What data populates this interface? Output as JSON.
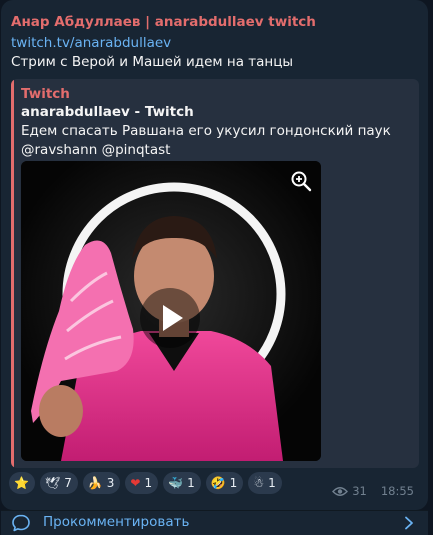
{
  "post": {
    "channel_name": "Анар Абдуллаев | anarabdullaev twitch",
    "link": "twitch.tv/anarabdullaev",
    "text": "Стрим с Верой и Машей идем на танцы"
  },
  "preview": {
    "site": "Twitch",
    "title": "anarabdullaev - Twitch",
    "description": "Едем спасать Равшана его укусил гондонский паук @ravshann @pinqtast"
  },
  "reactions": [
    {
      "emoji": "⭐",
      "icon": "star-icon",
      "count": ""
    },
    {
      "emoji": "🕊",
      "icon": "dove-icon",
      "count": "7"
    },
    {
      "emoji": "🍌",
      "icon": "banana-icon",
      "count": "3"
    },
    {
      "emoji": "❤",
      "icon": "heart-icon",
      "count": "1"
    },
    {
      "emoji": "🐳",
      "icon": "whale-icon",
      "count": "1"
    },
    {
      "emoji": "🤣",
      "icon": "rofl-icon",
      "count": "1"
    },
    {
      "emoji": "☃",
      "icon": "snowman-icon",
      "count": "1"
    }
  ],
  "meta": {
    "views": "31",
    "time": "18:55"
  },
  "comments": {
    "label": "Прокомментировать"
  },
  "colors": {
    "background": "#0e1621",
    "bubble": "#182533",
    "accent_red": "#e36d6d",
    "link_blue": "#6ab3f3",
    "reaction_bg": "#2b3a4d"
  }
}
